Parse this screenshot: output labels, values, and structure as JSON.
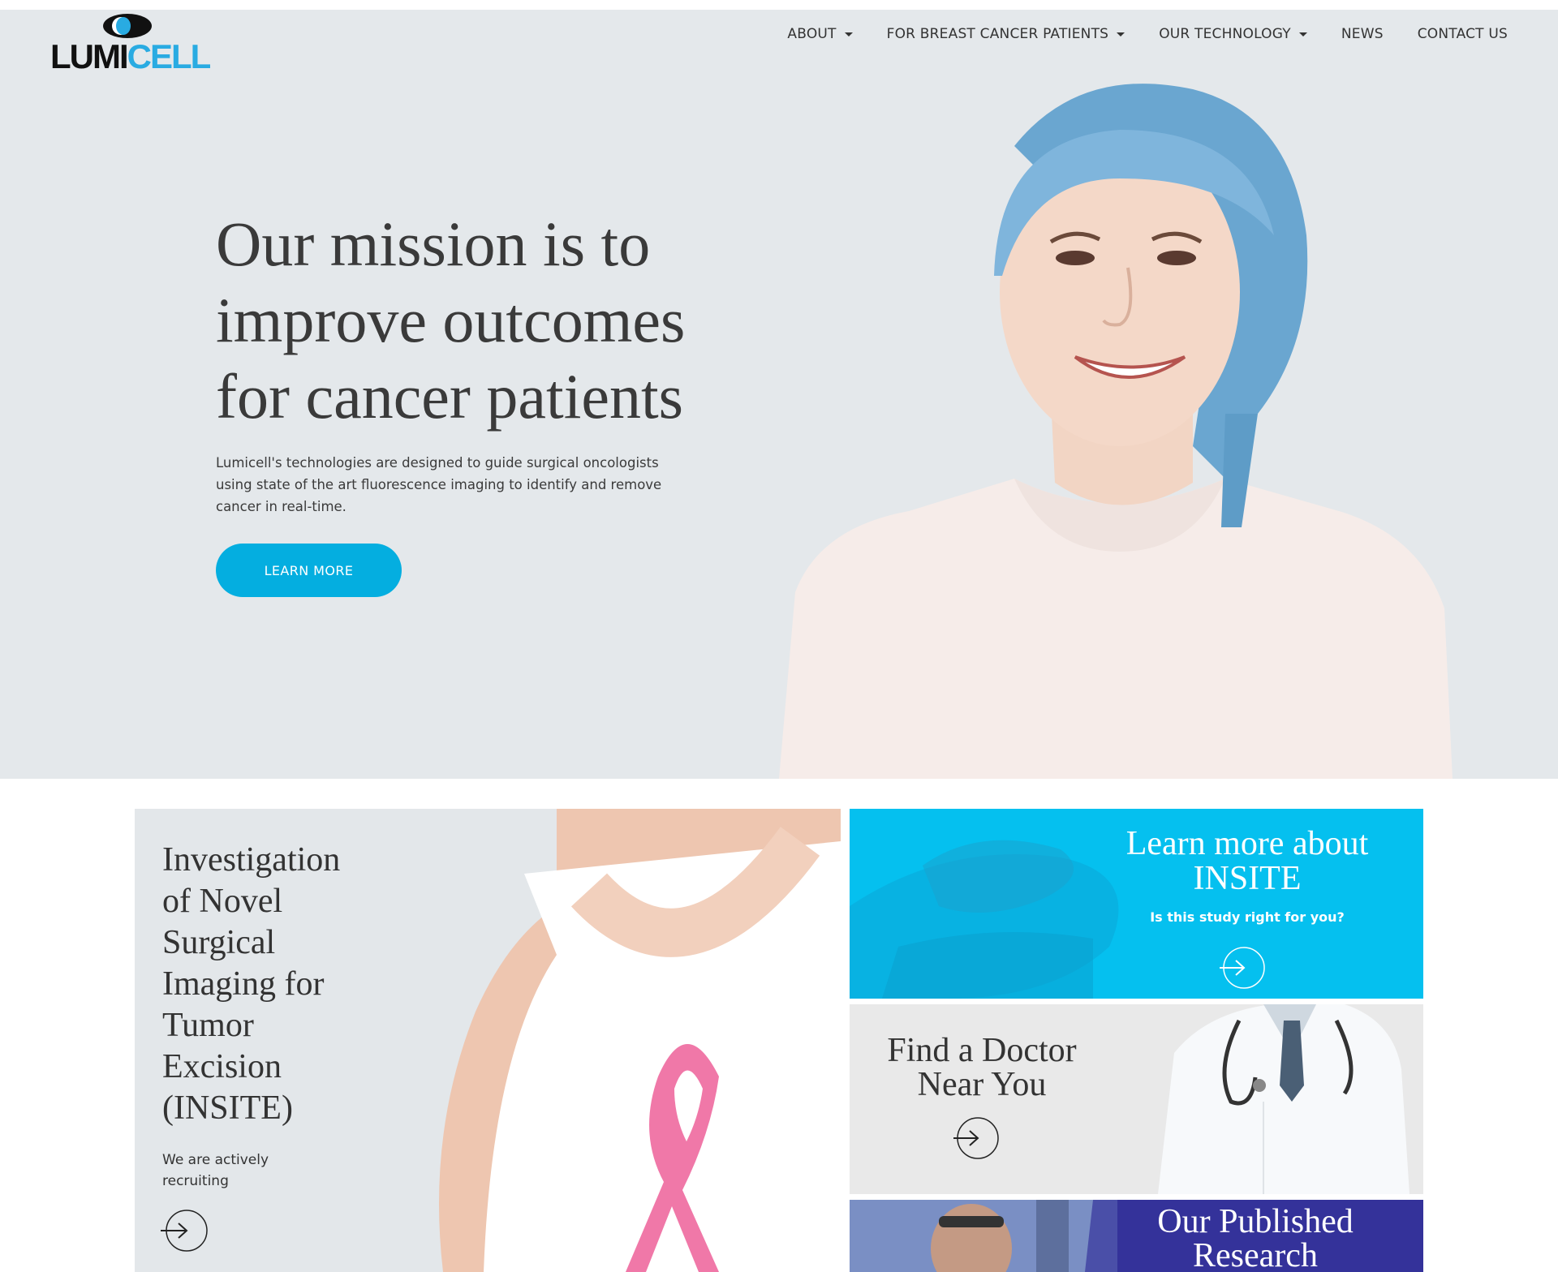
{
  "brand": {
    "logo_left": "LUMI",
    "logo_right": "CELL",
    "accent": "#04aee0",
    "logo_blue": "#29abe2"
  },
  "nav": {
    "items": [
      {
        "label": "ABOUT",
        "dropdown": true
      },
      {
        "label": "FOR BREAST CANCER PATIENTS",
        "dropdown": true
      },
      {
        "label": "OUR TECHNOLOGY",
        "dropdown": true
      },
      {
        "label": "NEWS",
        "dropdown": false
      },
      {
        "label": "CONTACT US",
        "dropdown": false
      }
    ]
  },
  "hero": {
    "title_line1": "Our mission is to",
    "title_line2": "improve outcomes",
    "title_line3": "for cancer patients",
    "body_line1": "Lumicell's technologies are designed to guide surgical oncologists",
    "body_line2": "using state of the art fluorescence imaging to identify and remove",
    "body_line3": "cancer in real-time.",
    "cta": "LEARN MORE"
  },
  "cards": {
    "study": {
      "title": "Investigation of Novel Surgical Imaging for Tumor Excision (INSITE)",
      "subtitle": "We are actively recruiting"
    },
    "insite": {
      "title_line1": "Learn more about",
      "title_line2": "INSITE",
      "subtitle": "Is this study right for you?"
    },
    "doctor": {
      "title_line1": "Find a Doctor",
      "title_line2": "Near You"
    },
    "research": {
      "title_line1": "Our Published",
      "title_line2": "Research"
    }
  },
  "icons": [
    "lumicell-logo-icon",
    "caret-down-icon",
    "arrow-right-circle-icon",
    "pink-ribbon-icon"
  ]
}
